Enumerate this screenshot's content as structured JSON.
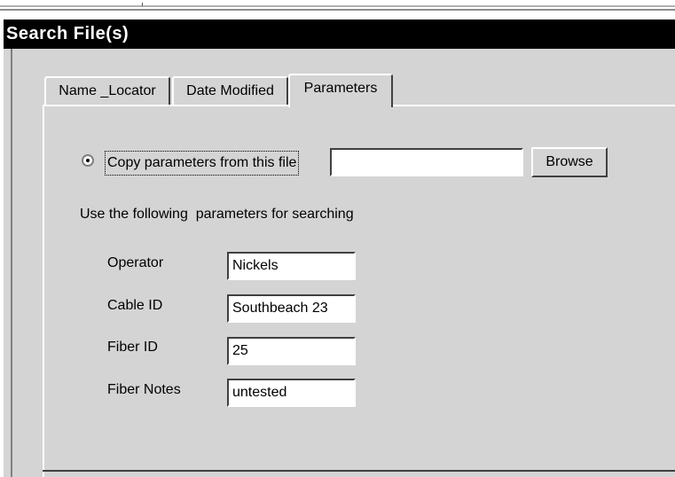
{
  "window": {
    "title": "Search File(s)"
  },
  "tabs": [
    {
      "label": "Name _Locator",
      "active": false
    },
    {
      "label": "Date Modified",
      "active": false
    },
    {
      "label": "Parameters",
      "active": true
    }
  ],
  "copy_params": {
    "radio_label": "Copy parameters from this file",
    "selected": true,
    "file_value": "",
    "browse_label": "Browse"
  },
  "section_label": "Use the following  parameters for searching",
  "fields": {
    "operator": {
      "label": "Operator",
      "value": "Nickels"
    },
    "cable_id": {
      "label": "Cable ID",
      "value": "Southbeach 23"
    },
    "fiber_id": {
      "label": "Fiber ID",
      "value": "25"
    },
    "fiber_notes": {
      "label": "Fiber Notes",
      "value": "untested"
    }
  }
}
